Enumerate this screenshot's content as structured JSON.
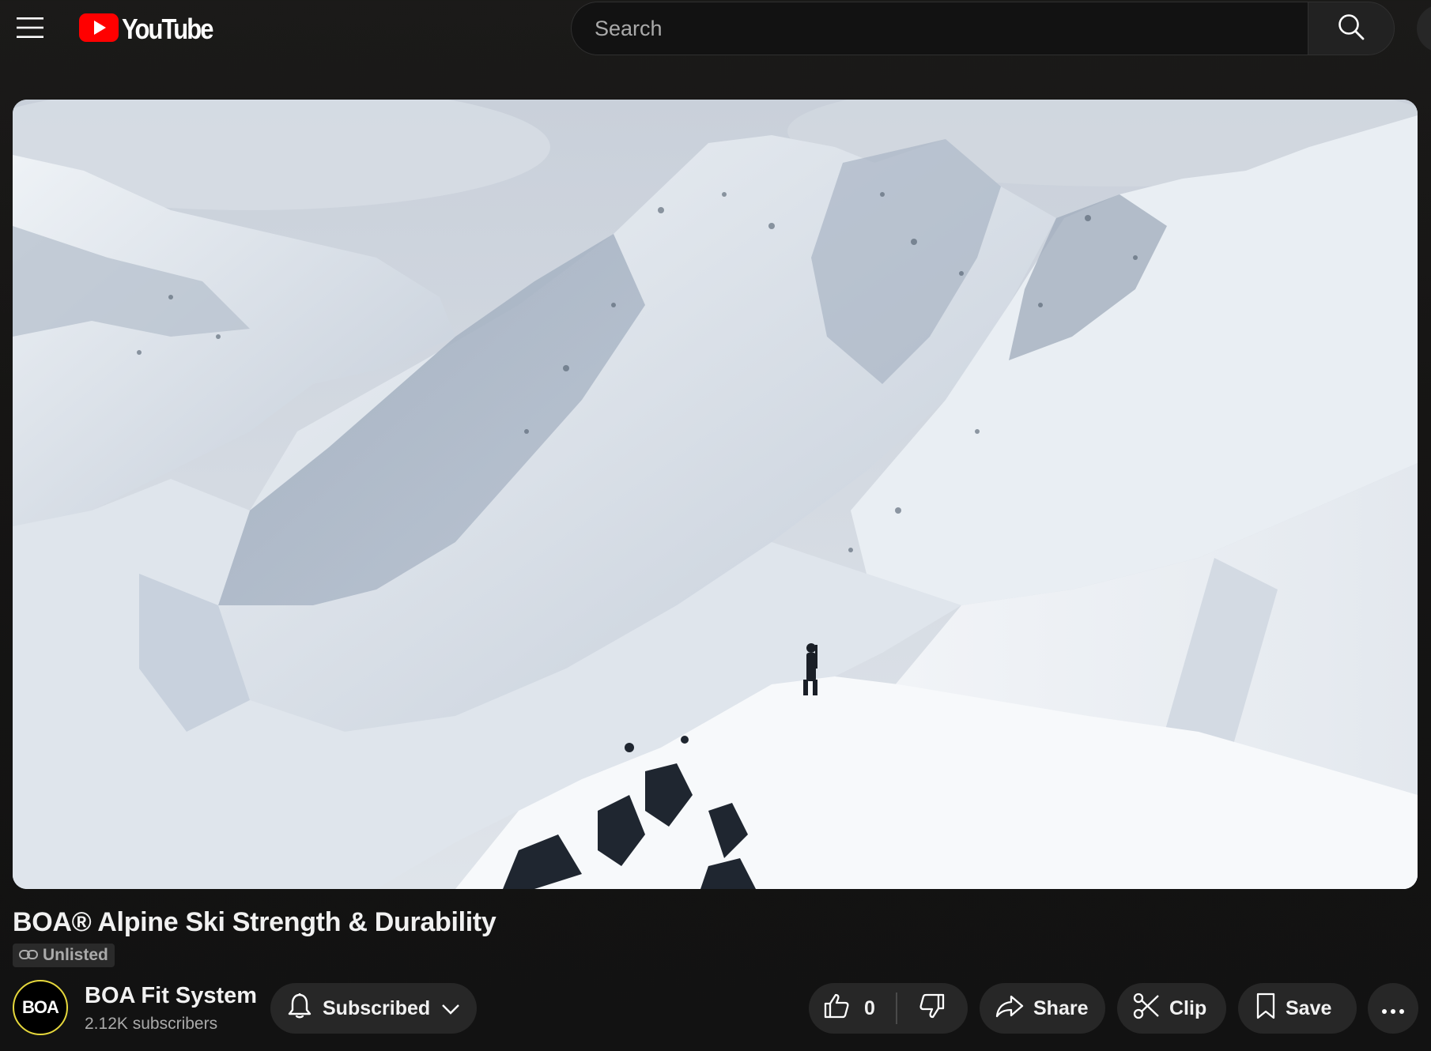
{
  "header": {
    "logo_text": "YouTube",
    "search_placeholder": "Search"
  },
  "video": {
    "title": "BOA® Alpine Ski Strength & Durability",
    "visibility": "Unlisted"
  },
  "channel": {
    "avatar_text": "BOA",
    "name": "BOA Fit System",
    "subscribers": "2.12K subscribers"
  },
  "actions": {
    "subscribed_label": "Subscribed",
    "like_count": "0",
    "share_label": "Share",
    "clip_label": "Clip",
    "save_label": "Save"
  },
  "colors": {
    "background": "#0f0f0f",
    "logo_red": "#ff0000",
    "pill_bg": "#272727",
    "avatar_ring": "#e6d83c"
  },
  "icons": [
    "menu-icon",
    "youtube-play-icon",
    "search-icon",
    "unlisted-link-icon",
    "bell-icon",
    "chevron-down-icon",
    "thumbs-up-icon",
    "thumbs-down-icon",
    "share-arrow-icon",
    "scissors-icon",
    "bookmark-icon",
    "more-horizontal-icon"
  ]
}
